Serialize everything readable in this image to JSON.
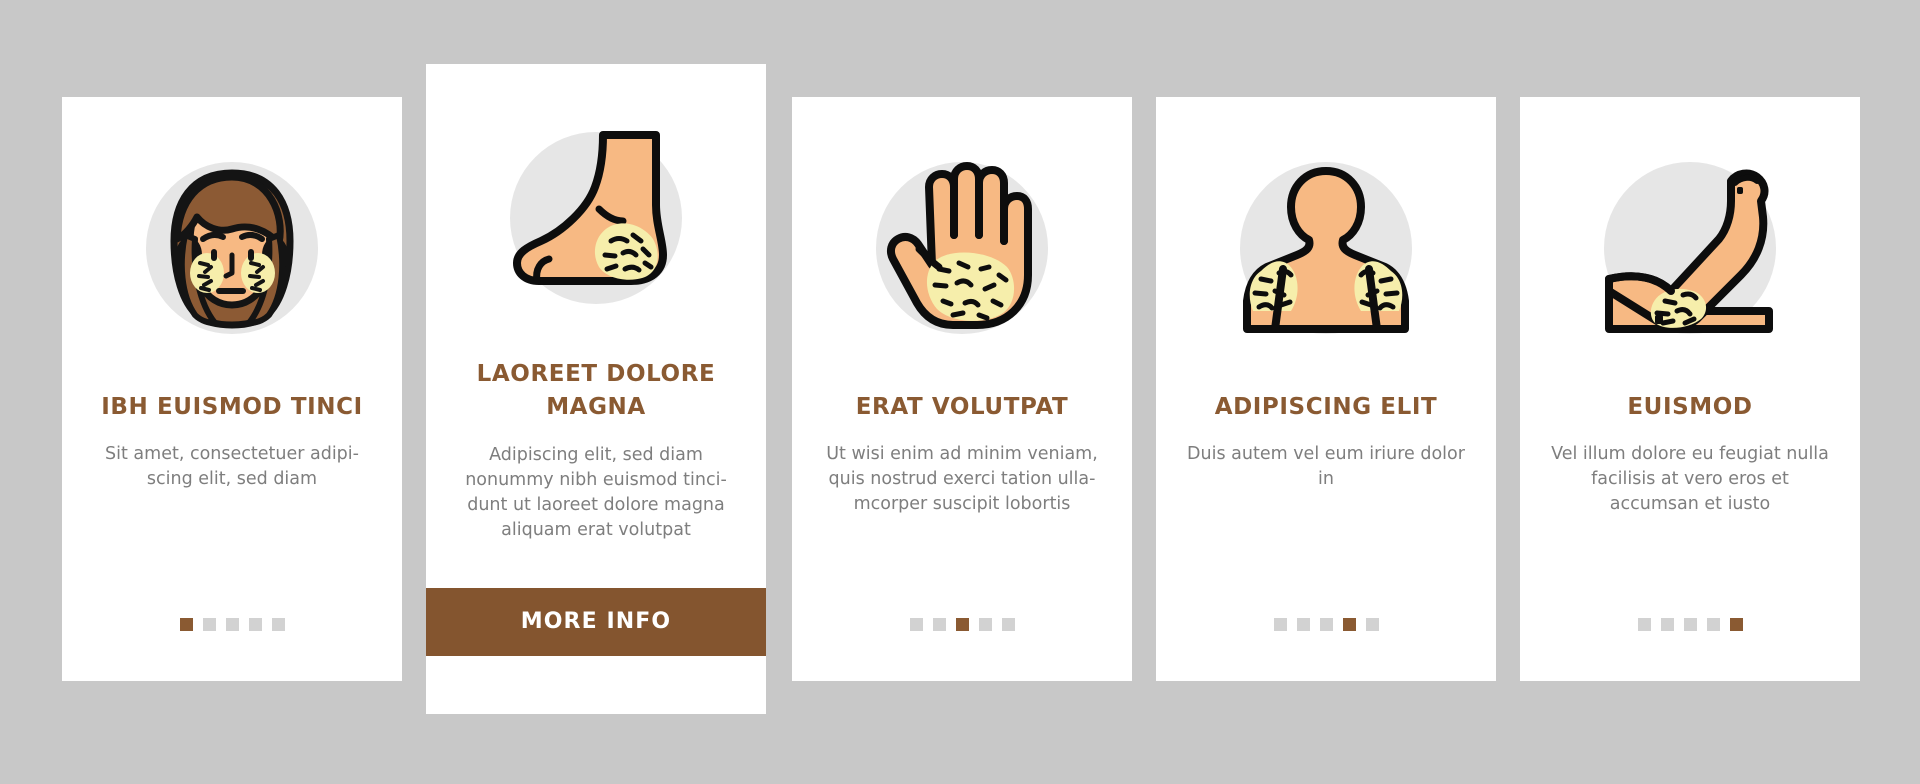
{
  "page": {
    "background_color": "#c8c8c8",
    "card_background": "#ffffff",
    "accent_color": "#8a5a32",
    "button_color": "#84552f",
    "dot_inactive_color": "#d2d2d2",
    "body_text_color": "#7e7e7e",
    "illustration_circle_color": "#e6e6e6",
    "skin_color": "#f7b983",
    "rash_color": "#f6eeab",
    "hair_color": "#8c5a34",
    "outline_color": "#0d0d0d"
  },
  "cards": [
    {
      "id": "card-1",
      "illustration": "face-rash-icon",
      "title": "IBH EUISMOD TINCI",
      "description": "Sit amet, consectetuer adipi-scing elit, sed diam",
      "dots_total": 5,
      "dot_active_index": 1,
      "featured": false
    },
    {
      "id": "card-2",
      "illustration": "foot-rash-icon",
      "title": "LAOREET DOLORE MAGNA",
      "description": "Adipiscing elit, sed diam nonummy nibh euismod tinci-dunt ut laoreet dolore magna aliquam erat volutpat",
      "button_label": "MORE INFO",
      "featured": true
    },
    {
      "id": "card-3",
      "illustration": "hand-palm-rash-icon",
      "title": "ERAT VOLUTPAT",
      "description": "Ut wisi enim ad minim veniam, quis nostrud exerci tation ulla-mcorper suscipit lobortis",
      "dots_total": 5,
      "dot_active_index": 3,
      "featured": false
    },
    {
      "id": "card-4",
      "illustration": "torso-shoulders-rash-icon",
      "title": "ADIPISCING ELIT",
      "description": "Duis autem vel eum iriure dolor in",
      "dots_total": 5,
      "dot_active_index": 4,
      "featured": false
    },
    {
      "id": "card-5",
      "illustration": "arm-elbow-rash-icon",
      "title": "EUISMOD",
      "description": "Vel illum dolore eu feugiat nulla facilisis at vero eros et accumsan et iusto",
      "dots_total": 5,
      "dot_active_index": 5,
      "featured": false
    }
  ]
}
